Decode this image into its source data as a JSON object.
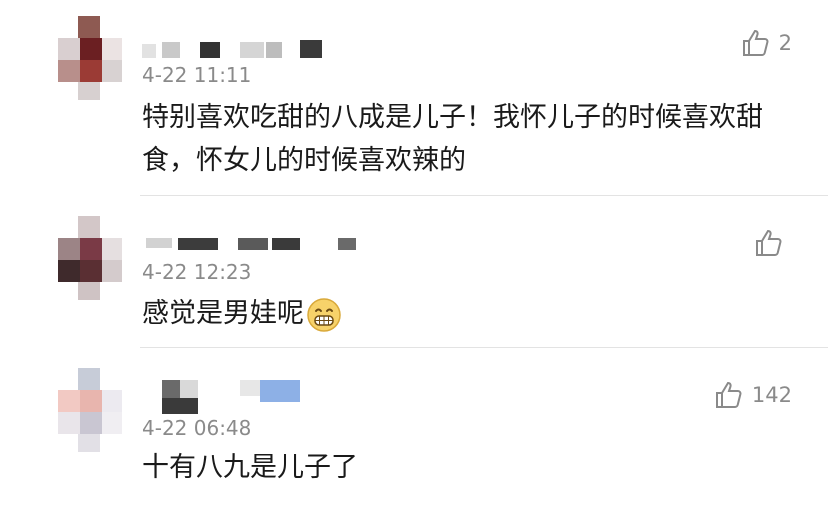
{
  "comments": [
    {
      "time": "4-22 11:11",
      "text": "特别喜欢吃甜的八成是儿子！我怀儿子的时候喜欢甜食，怀女儿的时候喜欢辣的",
      "likes": "2",
      "like_icon": "thumbs-up-icon"
    },
    {
      "time": "4-22 12:23",
      "text": "感觉是男娃呢",
      "emoji": "grinning-face-icon",
      "likes": "",
      "like_icon": "thumbs-up-icon"
    },
    {
      "time": "4-22 06:48",
      "text": "十有八九是儿子了",
      "likes": "142",
      "like_icon": "thumbs-up-icon"
    }
  ],
  "colors": {
    "text": "#1a1a1a",
    "meta": "#8a8a8a",
    "divider": "#e3e3e3"
  }
}
